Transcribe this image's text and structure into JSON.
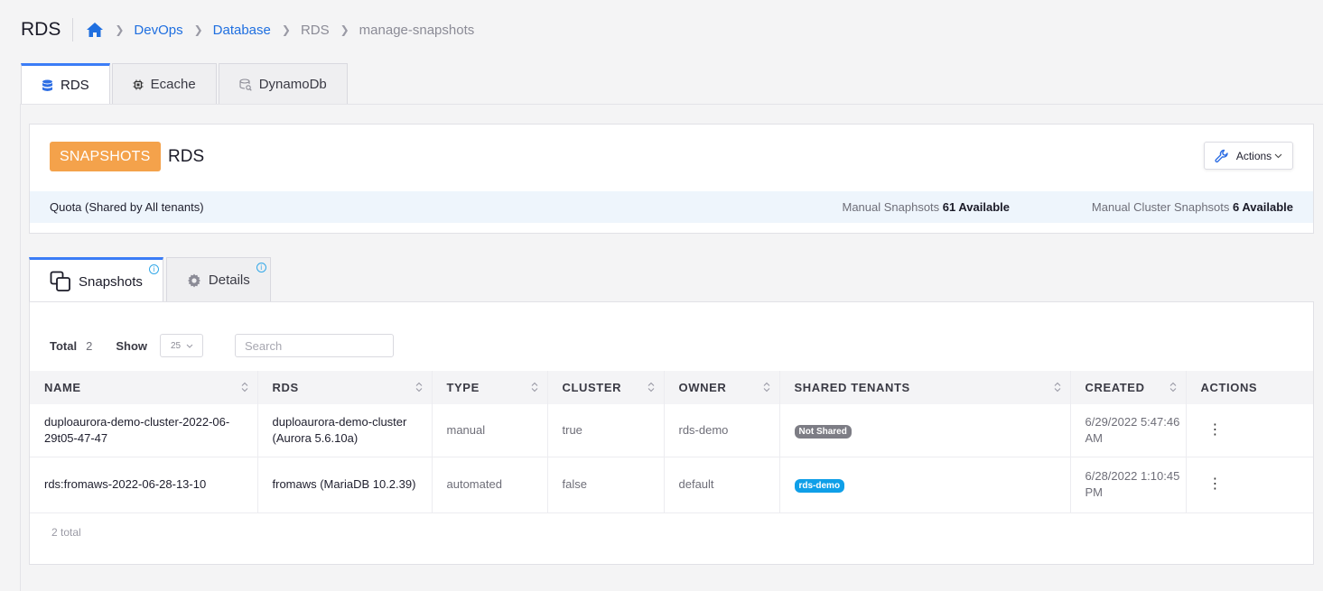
{
  "header": {
    "app_title": "RDS",
    "breadcrumb": [
      "DevOps",
      "Database",
      "RDS",
      "manage-snapshots"
    ]
  },
  "top_tabs": [
    {
      "label": "RDS",
      "icon": "database-icon",
      "active": true
    },
    {
      "label": "Ecache",
      "icon": "chip-icon",
      "active": false
    },
    {
      "label": "DynamoDb",
      "icon": "db-search-icon",
      "active": false
    }
  ],
  "card": {
    "badge": "SNAPSHOTS",
    "title": "RDS",
    "actions_label": "Actions",
    "quota_label": "Quota (Shared by All tenants)",
    "manual_label": "Manual Snaphsots",
    "manual_value": "61 Available",
    "cluster_label": "Manual Cluster Snaphsots",
    "cluster_value": "6 Available"
  },
  "sub_tabs": [
    {
      "label": "Snapshots",
      "icon": "copy-icon",
      "active": true
    },
    {
      "label": "Details",
      "icon": "gear-icon",
      "active": false
    }
  ],
  "toolbar": {
    "total_label": "Total",
    "total_value": "2",
    "show_label": "Show",
    "show_value": "25",
    "search_placeholder": "Search"
  },
  "table": {
    "columns": [
      "NAME",
      "RDS",
      "TYPE",
      "CLUSTER",
      "OWNER",
      "SHARED TENANTS",
      "CREATED",
      "ACTIONS"
    ],
    "rows": [
      {
        "name": "duploaurora-demo-cluster-2022-06-29t05-47-47",
        "rds": "duploaurora-demo-cluster (Aurora 5.6.10a)",
        "type": "manual",
        "cluster": "true",
        "owner": "rds-demo",
        "shared": "Not Shared",
        "created": "6/29/2022 5:47:46 AM"
      },
      {
        "name": "rds:fromaws-2022-06-28-13-10",
        "rds": "fromaws (MariaDB 10.2.39)",
        "type": "automated",
        "cluster": "false",
        "owner": "default",
        "shared": "rds-demo",
        "created": "6/28/2022 1:10:45 PM"
      }
    ],
    "footer": "2 total"
  },
  "colors": {
    "accent": "#3b7cf6",
    "badge_orange": "#f4a24b",
    "tag_gray": "#7d7d85",
    "tag_blue": "#0f9fe8"
  }
}
